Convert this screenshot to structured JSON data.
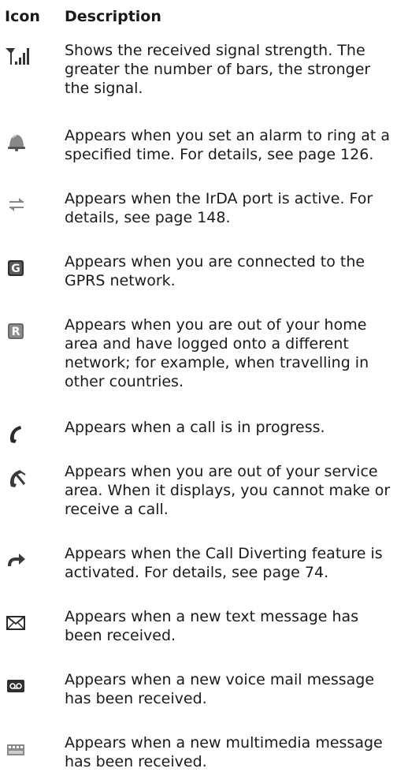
{
  "header": {
    "icon": "Icon",
    "description": "Description"
  },
  "rows": [
    {
      "icon": "signal-strength-icon",
      "text": "Shows the received signal strength. The\ngreater the number of bars, the stronger\nthe signal."
    },
    {
      "icon": "alarm-bell-icon",
      "text": "Appears when you set an alarm to ring at a\nspecified time. For details, see page 126."
    },
    {
      "icon": "irda-icon",
      "text": "Appears when the IrDA port is active. For\ndetails, see page 148."
    },
    {
      "icon": "gprs-icon",
      "text": "Appears when you are connected to the\nGPRS network."
    },
    {
      "icon": "roaming-icon",
      "text": "Appears when you are out of your home\narea and have logged onto a different\nnetwork; for example, when travelling in\nother countries."
    },
    {
      "icon": "call-in-progress-icon",
      "text": "Appears when a call is in progress."
    },
    {
      "icon": "no-service-icon",
      "text": "Appears when you are out of your service\narea. When it displays, you cannot make or\nreceive a call."
    },
    {
      "icon": "call-divert-icon",
      "text": "Appears when the Call Diverting feature is\nactivated. For details, see page 74."
    },
    {
      "icon": "text-message-icon",
      "text": "Appears when a new text message has\nbeen received."
    },
    {
      "icon": "voice-mail-icon",
      "text": "Appears when a new voice mail message\nhas been received."
    },
    {
      "icon": "multimedia-message-icon",
      "text": "Appears when a new multimedia message\nhas been received."
    }
  ]
}
